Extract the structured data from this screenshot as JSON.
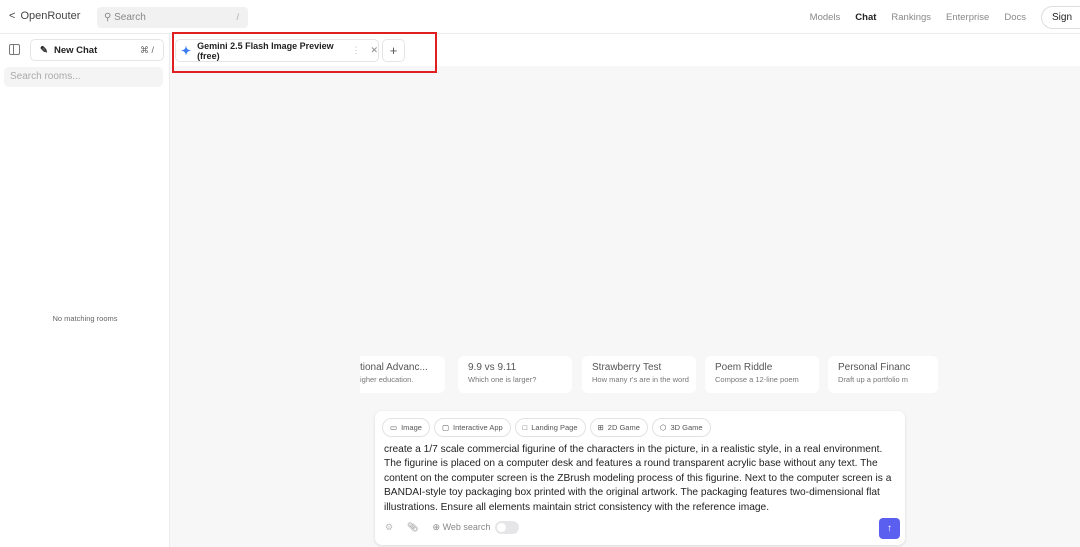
{
  "header": {
    "logo": "OpenRouter",
    "search_placeholder": "Search",
    "search_shortcut": "/",
    "nav": [
      "Models",
      "Chat",
      "Rankings",
      "Enterprise",
      "Docs"
    ],
    "sign_in": "Sign"
  },
  "sidebar": {
    "new_chat": "New Chat",
    "new_chat_shortcut": "⌘ /",
    "search_rooms_placeholder": "Search rooms...",
    "empty": "No matching rooms"
  },
  "tab": {
    "label": "Gemini 2.5 Flash Image Preview (free)"
  },
  "cards": [
    {
      "title": "tional Advanc...",
      "subtitle": "igher education."
    },
    {
      "title": "9.9 vs 9.11",
      "subtitle": "Which one is larger?"
    },
    {
      "title": "Strawberry Test",
      "subtitle": "How many r's are in the word"
    },
    {
      "title": "Poem Riddle",
      "subtitle": "Compose a 12-line poem"
    },
    {
      "title": "Personal Financ",
      "subtitle": "Draft up a portfolio m"
    }
  ],
  "chips": [
    {
      "icon": "image-icon",
      "glyph": "▭",
      "label": "Image"
    },
    {
      "icon": "app-icon",
      "glyph": "▢",
      "label": "Interactive App"
    },
    {
      "icon": "monitor-icon",
      "glyph": "□",
      "label": "Landing Page"
    },
    {
      "icon": "grid-icon",
      "glyph": "⊞",
      "label": "2D Game"
    },
    {
      "icon": "cube-icon",
      "glyph": "⬡",
      "label": "3D Game"
    }
  ],
  "prompt": "create a 1/7 scale commercial figurine of the characters in the picture, in a realistic style, in a real environment. The figurine is placed on a computer desk and features a round transparent acrylic base without any text. The content on the computer screen is the ZBrush modeling process of this figurine. Next to the computer screen is a BANDAI-style toy packaging box printed with the original artwork. The packaging features two-dimensional flat illustrations. Ensure all elements maintain strict consistency with the reference image.",
  "web_search": "Web search"
}
